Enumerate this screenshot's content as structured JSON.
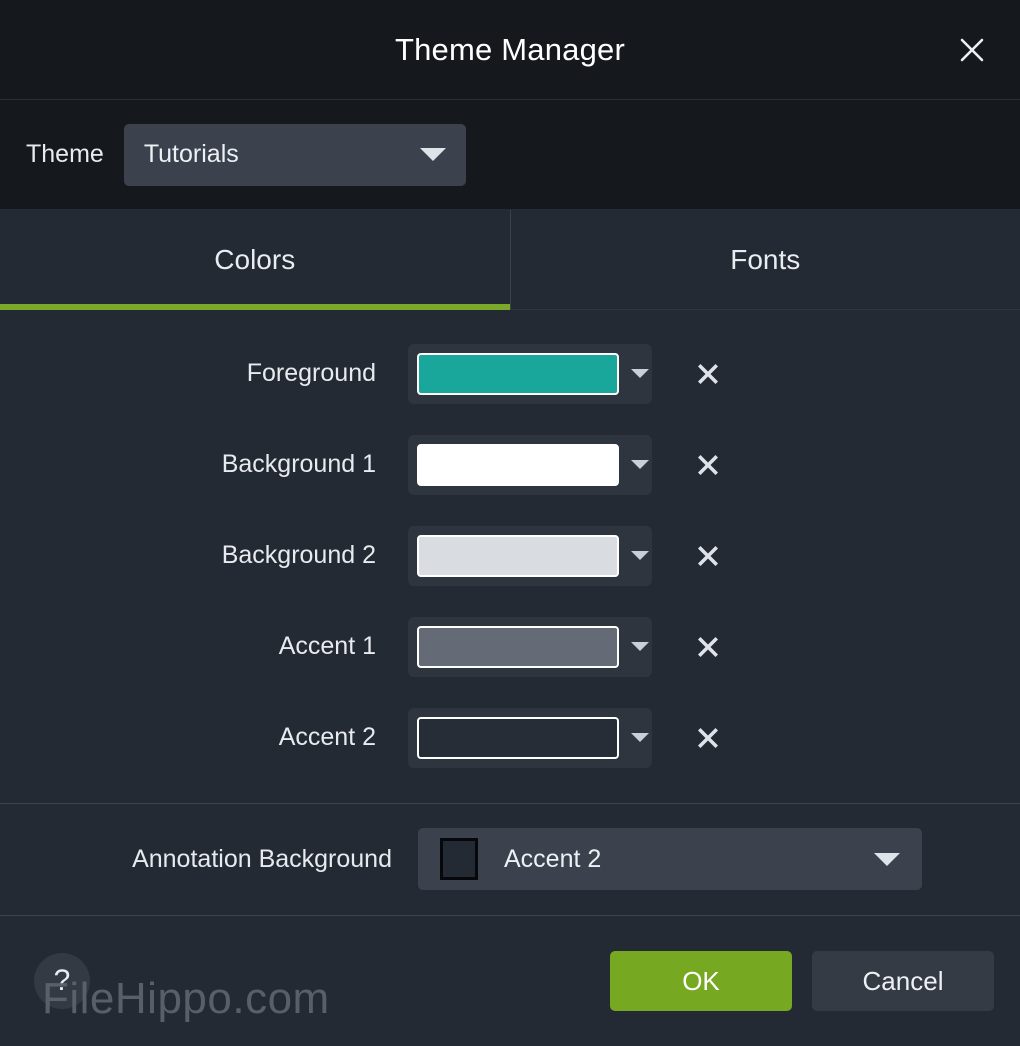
{
  "window": {
    "title": "Theme Manager",
    "close_icon": "close-icon"
  },
  "theme_bar": {
    "label": "Theme",
    "selected": "Tutorials",
    "caret_icon": "chevron-down-icon"
  },
  "tabs": [
    {
      "label": "Colors",
      "active": true
    },
    {
      "label": "Fonts",
      "active": false
    }
  ],
  "colors": {
    "accent_underline": "#79a82b",
    "rows": [
      {
        "label": "Foreground",
        "swatch": "#1aa79b",
        "clear_icon": "clear-icon",
        "caret_icon": "chevron-down-icon"
      },
      {
        "label": "Background 1",
        "swatch": "#ffffff",
        "clear_icon": "clear-icon",
        "caret_icon": "chevron-down-icon"
      },
      {
        "label": "Background 2",
        "swatch": "#d9dce0",
        "clear_icon": "clear-icon",
        "caret_icon": "chevron-down-icon"
      },
      {
        "label": "Accent 1",
        "swatch": "#646b76",
        "clear_icon": "clear-icon",
        "caret_icon": "chevron-down-icon"
      },
      {
        "label": "Accent 2",
        "swatch": "#272d36",
        "clear_icon": "clear-icon",
        "caret_icon": "chevron-down-icon"
      }
    ]
  },
  "annotation": {
    "label": "Annotation Background",
    "value": "Accent 2",
    "swatch": "#242a33",
    "caret_icon": "chevron-down-icon"
  },
  "footer": {
    "help_label": "?",
    "ok_label": "OK",
    "cancel_label": "Cancel",
    "ok_color": "#76a821"
  },
  "watermark": {
    "text": "FileHippo.com"
  }
}
